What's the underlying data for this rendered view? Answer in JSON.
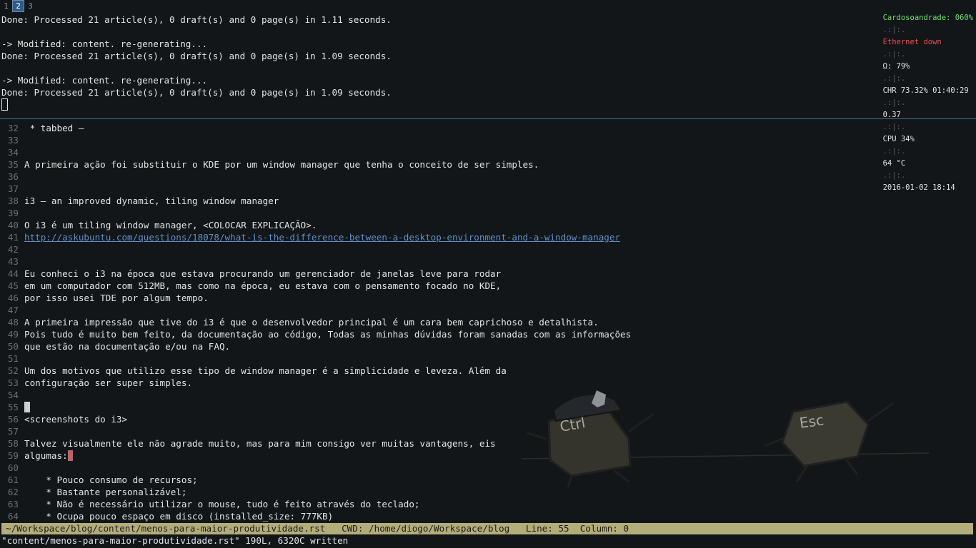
{
  "workspaces": [
    {
      "label": "1",
      "active": false
    },
    {
      "label": "2",
      "active": true
    },
    {
      "label": "3",
      "active": false
    }
  ],
  "status_bar": {
    "wifi": "Cardosoandrade: 060%",
    "ethernet": "Ethernet down",
    "volume": "Ω: 79%",
    "battery": "CHR 73.32% 01:40:29",
    "load": "0.37",
    "cpu": "CPU 34%",
    "temp": "64 °C",
    "datetime": "2016-01-02 18:14",
    "separator": ".:|:.",
    "colors": {
      "good": "#6fe16f",
      "bad": "#ef4c4c"
    }
  },
  "terminal": {
    "lines": [
      "Done: Processed 21 article(s), 0 draft(s) and 0 page(s) in 1.11 seconds.",
      "",
      "-> Modified: content. re-generating...",
      "Done: Processed 21 article(s), 0 draft(s) and 0 page(s) in 1.09 seconds.",
      "",
      "-> Modified: content. re-generating...",
      "Done: Processed 21 article(s), 0 draft(s) and 0 page(s) in 1.09 seconds."
    ]
  },
  "editor": {
    "lines": [
      {
        "n": "32",
        "text": " * tabbed –"
      },
      {
        "n": "33",
        "text": ""
      },
      {
        "n": "34",
        "text": ""
      },
      {
        "n": "35",
        "text": "A primeira ação foi substituir o KDE por um window manager que tenha o conceito de ser simples."
      },
      {
        "n": "36",
        "text": ""
      },
      {
        "n": "37",
        "text": ""
      },
      {
        "n": "38",
        "text": "i3 – an improved dynamic, tiling window manager"
      },
      {
        "n": "39",
        "text": ""
      },
      {
        "n": "40",
        "text": "O i3 é um tiling window manager, <COLOCAR EXPLICAÇÃO>."
      },
      {
        "n": "41",
        "text": "http://askubuntu.com/questions/18078/what-is-the-difference-between-a-desktop-environment-and-a-window-manager",
        "link": true
      },
      {
        "n": "42",
        "text": ""
      },
      {
        "n": "43",
        "text": ""
      },
      {
        "n": "44",
        "text": "Eu conheci o i3 na época que estava procurando um gerenciador de janelas leve para rodar"
      },
      {
        "n": "45",
        "text": "em um computador com 512MB, mas como na época, eu estava com o pensamento focado no KDE,"
      },
      {
        "n": "46",
        "text": "por isso usei TDE por algum tempo."
      },
      {
        "n": "47",
        "text": ""
      },
      {
        "n": "48",
        "text": "A primeira impressão que tive do i3 é que o desenvolvedor principal é um cara bem caprichoso e detalhista."
      },
      {
        "n": "49",
        "text": "Pois tudo é muito bem feito, da documentação ao código, Todas as minhas dúvidas foram sanadas com as informações"
      },
      {
        "n": "50",
        "text": "que estão na documentação e/ou na FAQ."
      },
      {
        "n": "51",
        "text": ""
      },
      {
        "n": "52",
        "text": "Um dos motivos que utilizo esse tipo de window manager é a simplicidade e leveza. Além da"
      },
      {
        "n": "53",
        "text": "configuração ser super simples."
      },
      {
        "n": "54",
        "text": ""
      },
      {
        "n": "55",
        "text": "",
        "cursor": "white"
      },
      {
        "n": "56",
        "text": "<screenshots do i3>"
      },
      {
        "n": "57",
        "text": ""
      },
      {
        "n": "58",
        "text": "Talvez visualmente ele não agrade muito, mas para mim consigo ver muitas vantagens, eis"
      },
      {
        "n": "59",
        "text": "algumas:",
        "cursor": "red"
      },
      {
        "n": "60",
        "text": ""
      },
      {
        "n": "61",
        "text": "    * Pouco consumo de recursos;"
      },
      {
        "n": "62",
        "text": "    * Bastante personalizável;"
      },
      {
        "n": "63",
        "text": "    * Não é necessário utilizar o mouse, tudo é feito através do teclado;"
      },
      {
        "n": "64",
        "text": "    * Ocupa pouco espaço em disco (installed_size: 777KB)"
      }
    ]
  },
  "vim_statusline": {
    "file": "~/Workspace/blog/content/menos-para-maior-produtividade.rst",
    "cwd_label": "CWD:",
    "cwd": "/home/diogo/Workspace/blog",
    "line_label": "Line:",
    "line": "55",
    "column_label": "Column:",
    "column": "0",
    "color": "#b3ad7a"
  },
  "vim_message": "\"content/menos-para-maior-produtividade.rst\" 190L, 6320C written",
  "wallpaper": {
    "key1": "Ctrl",
    "key2": "Esc"
  }
}
